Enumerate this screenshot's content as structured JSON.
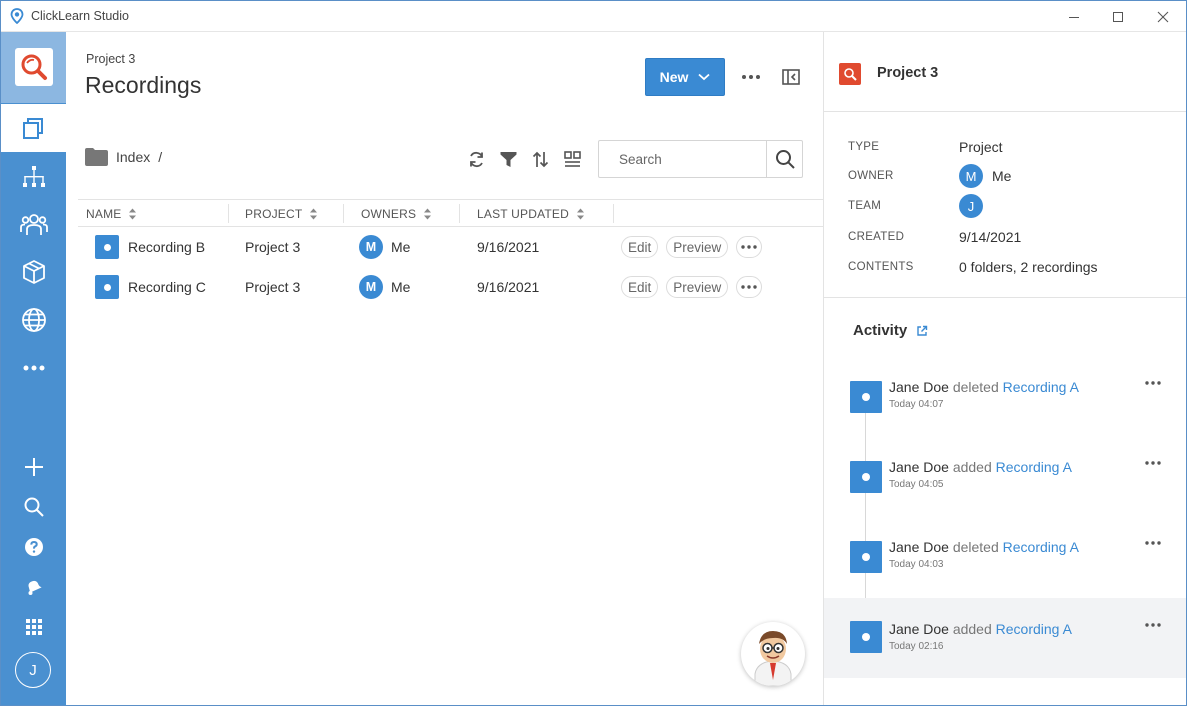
{
  "app": {
    "title": "ClickLearn Studio"
  },
  "colors": {
    "accent": "#3a8ad3",
    "rail": "#4a90d0",
    "project_icon": "#e04a2f"
  },
  "rail": {
    "items": [
      {
        "name": "content-icon",
        "active": true
      },
      {
        "name": "hierarchy-icon"
      },
      {
        "name": "users-icon"
      },
      {
        "name": "package-icon"
      },
      {
        "name": "globe-icon"
      },
      {
        "name": "more-icon"
      },
      {
        "name": "add-icon"
      },
      {
        "name": "search-icon"
      },
      {
        "name": "help-icon"
      },
      {
        "name": "notifications-icon"
      },
      {
        "name": "apps-grid-icon"
      }
    ],
    "user_initial": "J"
  },
  "header": {
    "breadcrumb": "Project 3",
    "title": "Recordings",
    "new_label": "New"
  },
  "folder": {
    "name": "Index",
    "separator": "/"
  },
  "search": {
    "placeholder": "Search"
  },
  "table": {
    "headers": [
      "NAME",
      "PROJECT",
      "OWNERS",
      "LAST UPDATED"
    ],
    "rows": [
      {
        "name": "Recording B",
        "project": "Project 3",
        "owner_initial": "M",
        "owner": "Me",
        "updated": "9/16/2021",
        "edit": "Edit",
        "preview": "Preview"
      },
      {
        "name": "Recording C",
        "project": "Project 3",
        "owner_initial": "M",
        "owner": "Me",
        "updated": "9/16/2021",
        "edit": "Edit",
        "preview": "Preview"
      }
    ]
  },
  "panel": {
    "title": "Project 3",
    "props": {
      "type_label": "TYPE",
      "type_value": "Project",
      "owner_label": "OWNER",
      "owner_initial": "M",
      "owner_value": "Me",
      "team_label": "TEAM",
      "team_initial": "J",
      "created_label": "CREATED",
      "created_value": "9/14/2021",
      "contents_label": "CONTENTS",
      "contents_value": "0 folders, 2 recordings"
    },
    "activity_title": "Activity",
    "activity": [
      {
        "user": "Jane Doe",
        "action": "deleted",
        "target": "Recording A",
        "time": "Today 04:07"
      },
      {
        "user": "Jane Doe",
        "action": "added",
        "target": "Recording A",
        "time": "Today 04:05"
      },
      {
        "user": "Jane Doe",
        "action": "deleted",
        "target": "Recording A",
        "time": "Today 04:03"
      },
      {
        "user": "Jane Doe",
        "action": "added",
        "target": "Recording A",
        "time": "Today 02:16"
      }
    ]
  }
}
